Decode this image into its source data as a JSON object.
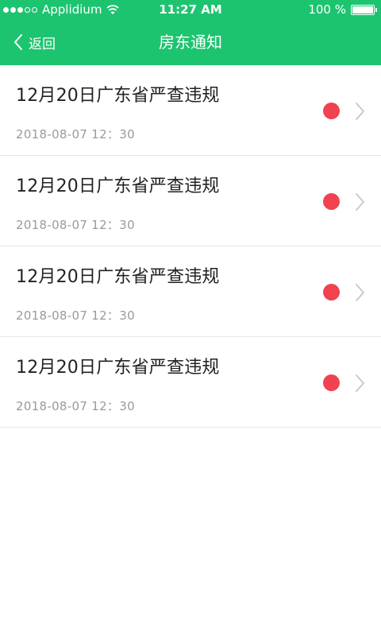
{
  "status_bar": {
    "carrier": "Applidium",
    "time": "11:27 AM",
    "battery": "100 %"
  },
  "nav": {
    "back_label": "返回",
    "title": "房东通知"
  },
  "colors": {
    "primary": "#1dc46f",
    "unread": "#f0424f",
    "chevron": "#c7c7c7"
  },
  "notifications": [
    {
      "title": "12月20日广东省严查违规",
      "time": "2018-08-07 12：30",
      "unread": true
    },
    {
      "title": "12月20日广东省严查违规",
      "time": "2018-08-07 12：30",
      "unread": true
    },
    {
      "title": "12月20日广东省严查违规",
      "time": "2018-08-07 12：30",
      "unread": true
    },
    {
      "title": "12月20日广东省严查违规",
      "time": "2018-08-07 12：30",
      "unread": true
    }
  ]
}
